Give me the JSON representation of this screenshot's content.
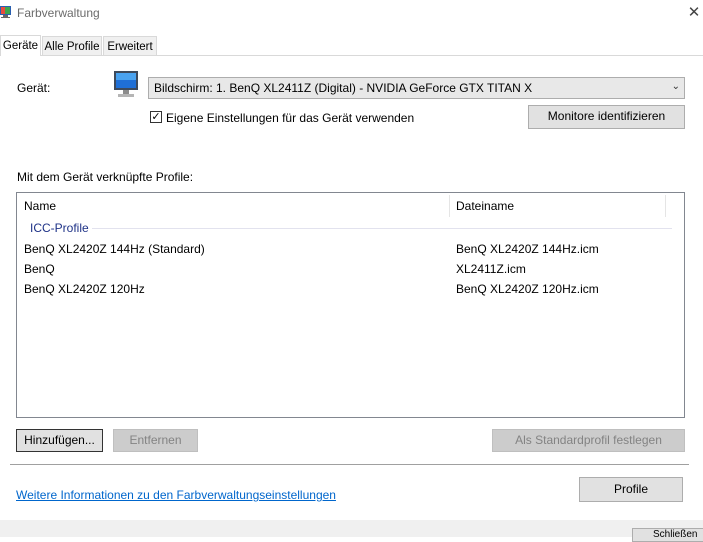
{
  "window": {
    "title": "Farbverwaltung",
    "close_glyph": "✕"
  },
  "tabs": [
    {
      "label": "Geräte",
      "active": true
    },
    {
      "label": "Alle Profile",
      "active": false
    },
    {
      "label": "Erweitert",
      "active": false
    }
  ],
  "device": {
    "label": "Gerät:",
    "icon": "monitor-icon",
    "selected": "Bildschirm: 1. BenQ XL2411Z (Digital) - NVIDIA GeForce GTX TITAN X",
    "own_settings_checked": true,
    "own_settings_label": "Eigene Einstellungen für das Gerät verwenden",
    "identify_button": "Monitore identifizieren"
  },
  "profiles": {
    "heading": "Mit dem Gerät verknüpfte Profile:",
    "columns": {
      "name": "Name",
      "file": "Dateiname"
    },
    "group": "ICC-Profile",
    "rows": [
      {
        "name": "BenQ XL2420Z 144Hz (Standard)",
        "file": "BenQ XL2420Z 144Hz.icm"
      },
      {
        "name": "BenQ",
        "file": "XL2411Z.icm"
      },
      {
        "name": "BenQ XL2420Z 120Hz",
        "file": "BenQ XL2420Z 120Hz.icm"
      }
    ]
  },
  "buttons": {
    "add": "Hinzufügen...",
    "remove": "Entfernen",
    "set_default": "Als Standardprofil festlegen",
    "profiles": "Profile"
  },
  "info_link": "Weitere Informationen zu den Farbverwaltungseinstellungen",
  "footer_button": "Schließen",
  "colors": {
    "link": "#0066cc",
    "group_label": "#1e3287",
    "button_face": "#e1e1e1",
    "disabled_button": "#cccccc"
  }
}
